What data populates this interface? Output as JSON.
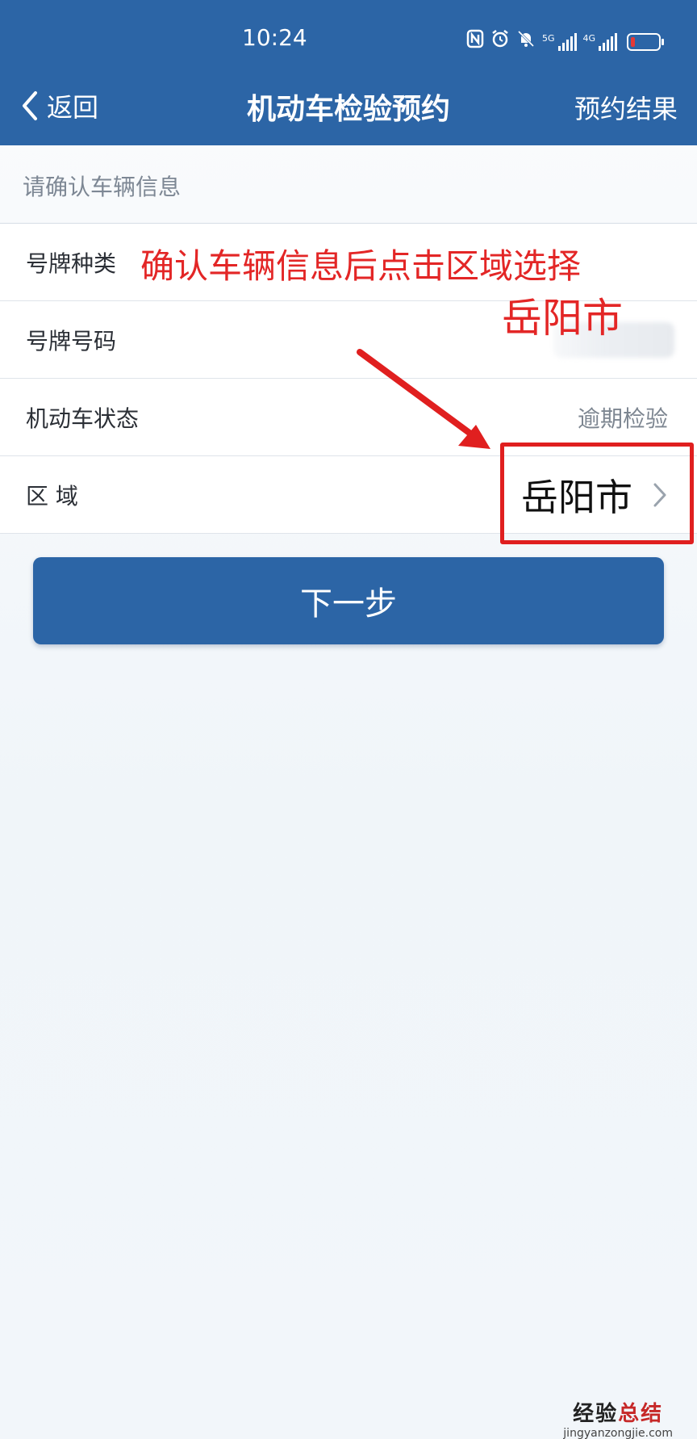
{
  "status_bar": {
    "time": "10:24",
    "signal1_label": "5G",
    "signal2_label": "4G",
    "battery_color": "#e53935"
  },
  "nav": {
    "back_label": "返回",
    "title": "机动车检验预约",
    "right_label": "预约结果"
  },
  "section_hint": "请确认车辆信息",
  "rows": [
    {
      "label": "号牌种类",
      "value": ""
    },
    {
      "label": "号牌号码",
      "value": ""
    },
    {
      "label": "机动车状态",
      "value": "逾期检验"
    },
    {
      "label": "区 域",
      "value": "岳阳市"
    }
  ],
  "next_button": "下一步",
  "annotation": {
    "line1": "确认车辆信息后点击区域选择",
    "line2": "岳阳市",
    "color": "#e32626"
  },
  "watermark": {
    "title_part1": "经验",
    "title_part2": "总结",
    "url": "jingyanzongjie.com"
  },
  "colors": {
    "brand": "#2c65a6",
    "text_primary": "#2b2f36",
    "text_secondary": "#7d8691"
  }
}
